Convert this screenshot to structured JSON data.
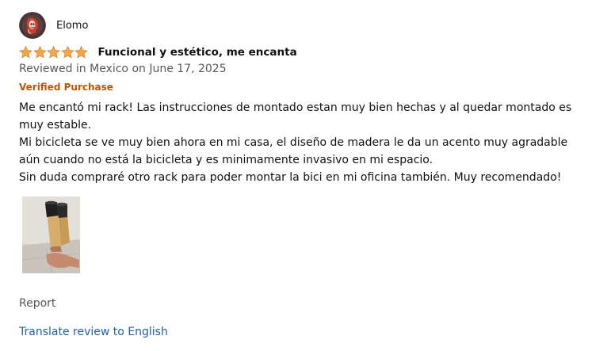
{
  "review": {
    "author": "Elomo",
    "avatar_icon": "profile-avatar-icon",
    "rating": 5,
    "rating_max": 5,
    "star_color": "#f3a847",
    "title": "Funcional y estético, me encanta",
    "date": "Reviewed in Mexico on June 17, 2025",
    "verified_label": "Verified Purchase",
    "verified_color": "#c45500",
    "body": [
      "Me encantó mi rack! Las instrucciones de montado estan muy bien hechas y al quedar montado es muy estable.",
      "Mi bicicleta se ve muy bien ahora en mi casa, el diseño de madera le da un acento muy agradable aún cuando no está la bicicleta y es minimamente invasivo en mi espacio.",
      "Sin duda compraré otro rack para poder montar la bici en mi oficina también. Muy recomendado!"
    ],
    "image_icon": "review-photo-thumbnail",
    "report_label": "Report",
    "translate_label": "Translate review to English",
    "link_color": "#2162a1"
  }
}
